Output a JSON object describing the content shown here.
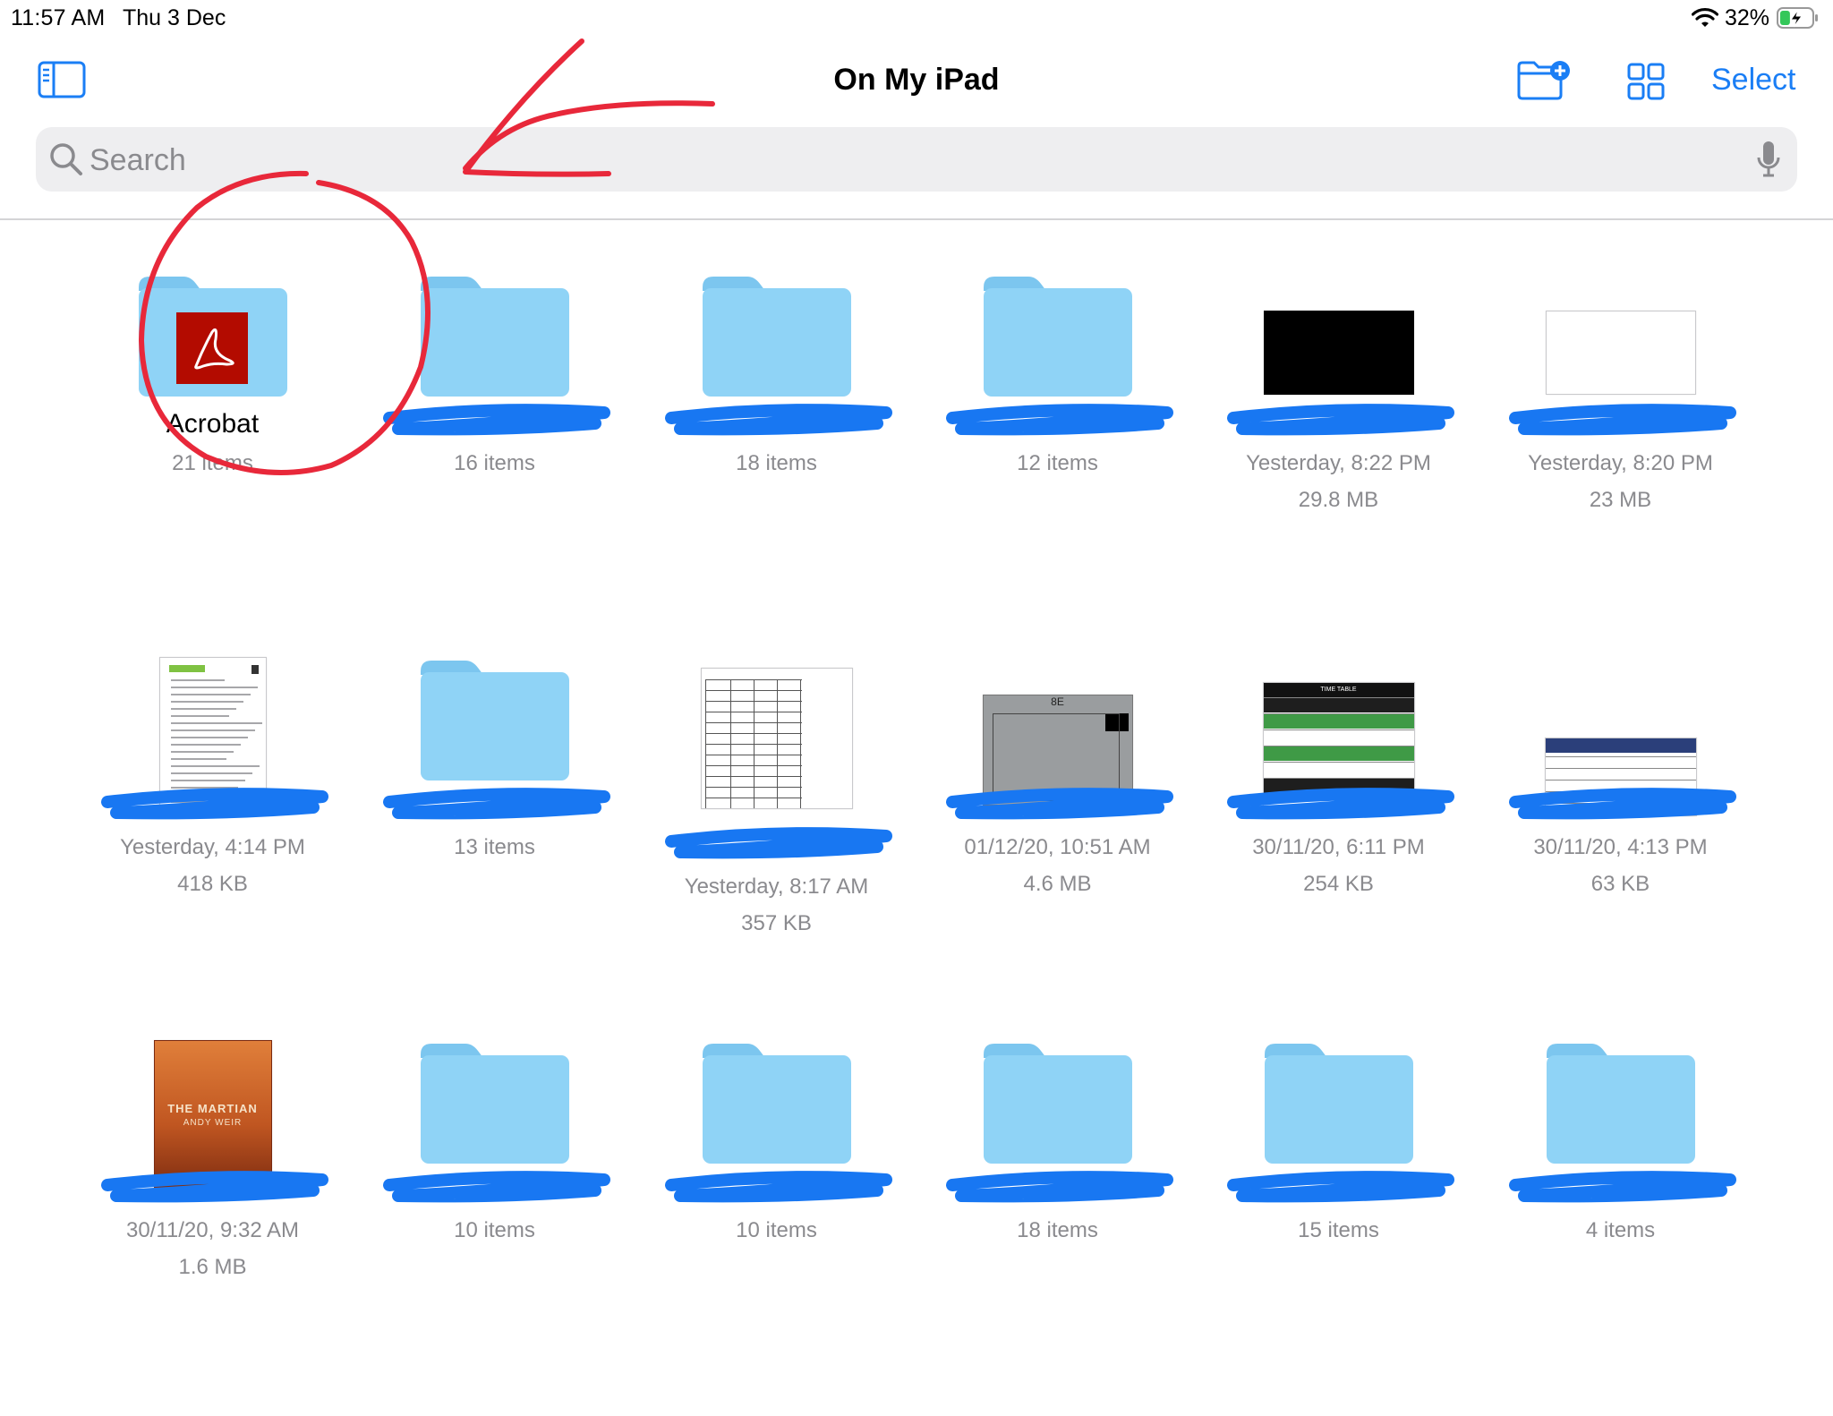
{
  "status_bar": {
    "time": "11:57 AM",
    "date": "Thu 3 Dec",
    "battery_percent": "32%",
    "battery_level": 0.32,
    "battery_charging": true
  },
  "nav": {
    "title": "On My iPad",
    "select_label": "Select",
    "accent_color": "#1a7ef5"
  },
  "search": {
    "placeholder": "Search"
  },
  "items": [
    {
      "kind": "folder-app",
      "icon": "acrobat-icon",
      "name": "Acrobat",
      "meta1": "21 items",
      "meta2": ""
    },
    {
      "kind": "folder",
      "name": "",
      "meta1": "16 items",
      "meta2": ""
    },
    {
      "kind": "folder",
      "name": "",
      "meta1": "18 items",
      "meta2": ""
    },
    {
      "kind": "folder",
      "name": "",
      "meta1": "12 items",
      "meta2": ""
    },
    {
      "kind": "file-black",
      "name": "",
      "meta1": "Yesterday, 8:22 PM",
      "meta2": "29.8 MB"
    },
    {
      "kind": "file-white",
      "name": "",
      "meta1": "Yesterday, 8:20 PM",
      "meta2": "23 MB"
    },
    {
      "kind": "document",
      "name": "",
      "meta1": "Yesterday, 4:14 PM",
      "meta2": "418 KB"
    },
    {
      "kind": "folder",
      "name": "",
      "meta1": "13 items",
      "meta2": ""
    },
    {
      "kind": "timetable",
      "name": "",
      "meta1": "Yesterday, 8:17 AM",
      "meta2": "357 KB"
    },
    {
      "kind": "photo",
      "name": "",
      "meta1": "01/12/20, 10:51 AM",
      "meta2": "4.6 MB",
      "photo_label": "8E"
    },
    {
      "kind": "timetable-color",
      "name": "",
      "meta1": "30/11/20, 6:11 PM",
      "meta2": "254 KB",
      "thumb_header": "TIME TABLE"
    },
    {
      "kind": "test-sheet",
      "name": "",
      "meta1": "30/11/20, 4:13 PM",
      "meta2": "63 KB"
    },
    {
      "kind": "book",
      "name": "",
      "meta1": "30/11/20, 9:32 AM",
      "meta2": "1.6 MB",
      "book_title": "THE MARTIAN",
      "book_author": "ANDY WEIR"
    },
    {
      "kind": "folder",
      "name": "",
      "meta1": "10 items",
      "meta2": ""
    },
    {
      "kind": "folder",
      "name": "",
      "meta1": "10 items",
      "meta2": ""
    },
    {
      "kind": "folder",
      "name": "",
      "meta1": "18 items",
      "meta2": ""
    },
    {
      "kind": "folder",
      "name": "",
      "meta1": "15 items",
      "meta2": ""
    },
    {
      "kind": "folder",
      "name": "",
      "meta1": "4 items",
      "meta2": ""
    }
  ],
  "colors": {
    "folder_body": "#8fd3f6",
    "folder_tab": "#7cc6ef",
    "meta_text": "#8a8a8e",
    "redaction": "#1877f2",
    "annotation": "#e8283a"
  }
}
